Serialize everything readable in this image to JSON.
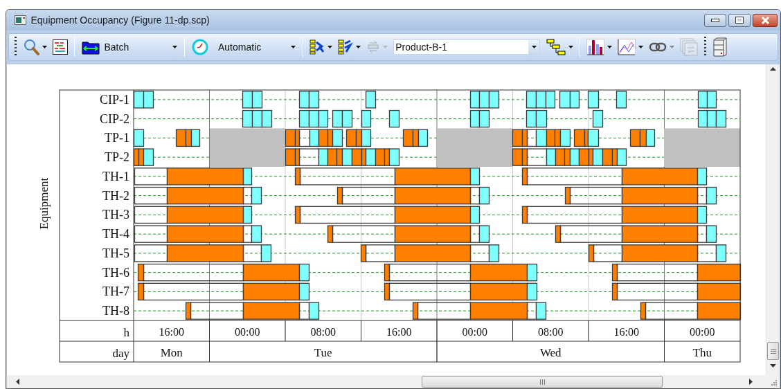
{
  "window": {
    "title": "Equipment Occupancy (Figure 11-dp.scp)"
  },
  "toolbar": [
    {
      "kind": "zoom",
      "disabled": false
    },
    {
      "kind": "gantt",
      "disabled": false
    },
    {
      "kind": "mode-combo",
      "value": "Batch"
    },
    {
      "kind": "schedule-combo",
      "value": "Automatic"
    },
    {
      "kind": "tree-down",
      "disabled": false
    },
    {
      "kind": "tree-up",
      "disabled": false
    },
    {
      "kind": "swap",
      "disabled": true
    },
    {
      "kind": "product-combo",
      "value": "Product-B-1"
    },
    {
      "kind": "cascade",
      "disabled": false
    },
    {
      "kind": "bar-chart",
      "disabled": false
    },
    {
      "kind": "line-chart",
      "disabled": false
    },
    {
      "kind": "link",
      "disabled": false
    },
    {
      "kind": "calendar",
      "disabled": true
    },
    {
      "kind": "database",
      "disabled": false
    }
  ],
  "chart": {
    "y_title": "Equipment",
    "rows": [
      "CIP-1",
      "CIP-2",
      "TP-1",
      "TP-2",
      "TH-1",
      "TH-2",
      "TH-3",
      "TH-4",
      "TH-5",
      "TH-6",
      "TH-7",
      "TH-8"
    ],
    "hour_label": "h",
    "hours": [
      "16:00",
      "00:00",
      "08:00",
      "16:00",
      "00:00",
      "08:00",
      "16:00",
      "00:00"
    ],
    "day_label": "day",
    "days": [
      "Mon",
      "Tue",
      "Wed",
      "Thu"
    ]
  }
}
